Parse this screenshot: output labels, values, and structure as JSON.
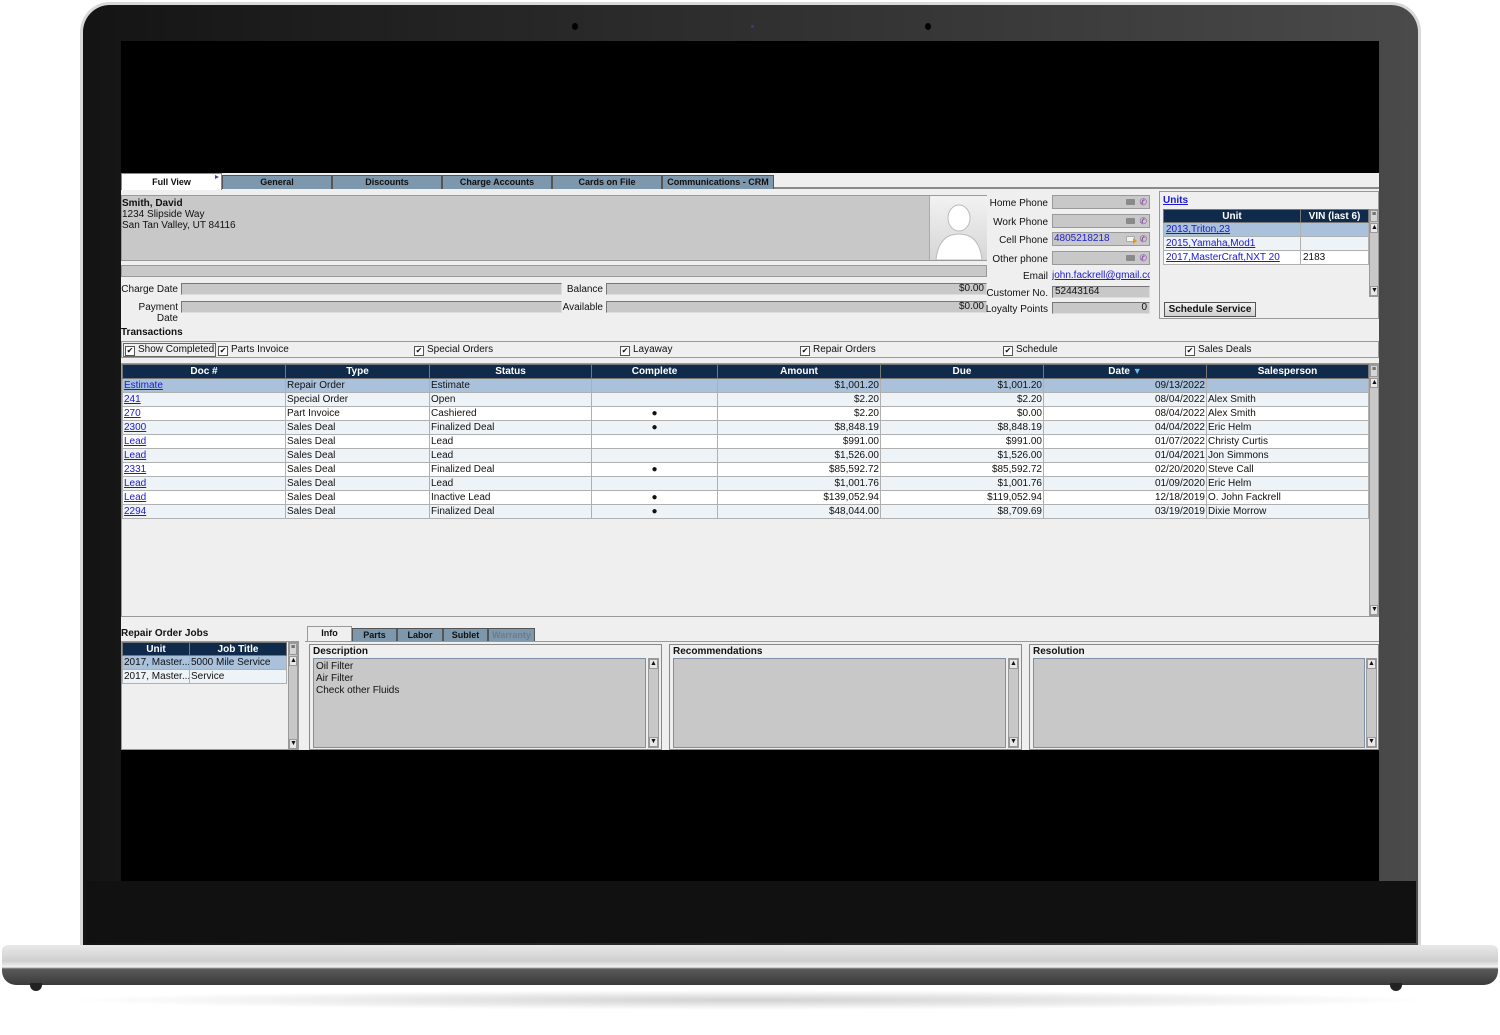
{
  "tabs": [
    {
      "label": "Full View",
      "active": true
    },
    {
      "label": "General"
    },
    {
      "label": "Discounts"
    },
    {
      "label": "Charge Accounts"
    },
    {
      "label": "Cards on File"
    },
    {
      "label": "Communications - CRM"
    }
  ],
  "customer": {
    "name": "Smith, David",
    "address1": "1234 Slipside Way",
    "address2": "San Tan Valley, UT 84116"
  },
  "account": {
    "charge_date_label": "Charge Date",
    "charge_date": "",
    "payment_date_label": "Payment Date",
    "payment_date": "",
    "balance_label": "Balance",
    "balance": "$0.00",
    "available_label": "Available",
    "available": "$0.00"
  },
  "contact": {
    "home_phone_label": "Home Phone",
    "home_phone": "",
    "work_phone_label": "Work Phone",
    "work_phone": "",
    "cell_phone_label": "Cell Phone",
    "cell_phone": "4805218218",
    "other_phone_label": "Other phone",
    "other_phone": "",
    "email_label": "Email",
    "email": "john.fackrell@gmail.cor",
    "customer_no_label": "Customer No.",
    "customer_no": "52443164",
    "loyalty_label": "Loyalty Points",
    "loyalty": "0"
  },
  "units": {
    "title": "Units",
    "columns": [
      "Unit",
      "VIN (last 6)"
    ],
    "rows": [
      {
        "unit": "2013,Triton,23",
        "vin": ""
      },
      {
        "unit": "2015,Yamaha,Mod1",
        "vin": ""
      },
      {
        "unit": "2017,MasterCraft,NXT 20",
        "vin": "2183"
      }
    ],
    "schedule_button": "Schedule Service"
  },
  "transactions": {
    "title": "Transactions",
    "filters": [
      {
        "label": "Show Completed",
        "checked": true
      },
      {
        "label": "Parts Invoice",
        "checked": true
      },
      {
        "label": "Special Orders",
        "checked": true
      },
      {
        "label": "Layaway",
        "checked": true
      },
      {
        "label": "Repair Orders",
        "checked": true
      },
      {
        "label": "Schedule",
        "checked": true
      },
      {
        "label": "Sales Deals",
        "checked": true
      }
    ],
    "columns": [
      "Doc #",
      "Type",
      "Status",
      "Complete",
      "Amount",
      "Due",
      "Date",
      "Salesperson"
    ],
    "sort_icon": "triangle-down",
    "rows": [
      {
        "doc": "Estimate",
        "type": "Repair Order",
        "status": "Estimate",
        "complete": "",
        "amount": "$1,001.20",
        "due": "$1,001.20",
        "date": "09/13/2022",
        "salesperson": ""
      },
      {
        "doc": "241",
        "type": "Special Order",
        "status": "Open",
        "complete": "",
        "amount": "$2.20",
        "due": "$2.20",
        "date": "08/04/2022",
        "salesperson": "Alex Smith"
      },
      {
        "doc": "270",
        "type": "Part Invoice",
        "status": "Cashiered",
        "complete": "●",
        "amount": "$2.20",
        "due": "$0.00",
        "date": "08/04/2022",
        "salesperson": "Alex Smith"
      },
      {
        "doc": "2300",
        "type": "Sales Deal",
        "status": "Finalized Deal",
        "complete": "●",
        "amount": "$8,848.19",
        "due": "$8,848.19",
        "date": "04/04/2022",
        "salesperson": "Eric Helm"
      },
      {
        "doc": "Lead",
        "type": "Sales Deal",
        "status": "Lead",
        "complete": "",
        "amount": "$991.00",
        "due": "$991.00",
        "date": "01/07/2022",
        "salesperson": "Christy Curtis"
      },
      {
        "doc": "Lead",
        "type": "Sales Deal",
        "status": "Lead",
        "complete": "",
        "amount": "$1,526.00",
        "due": "$1,526.00",
        "date": "01/04/2021",
        "salesperson": "Jon Simmons"
      },
      {
        "doc": "2331",
        "type": "Sales Deal",
        "status": "Finalized Deal",
        "complete": "●",
        "amount": "$85,592.72",
        "due": "$85,592.72",
        "date": "02/20/2020",
        "salesperson": "Steve Call"
      },
      {
        "doc": "Lead",
        "type": "Sales Deal",
        "status": "Lead",
        "complete": "",
        "amount": "$1,001.76",
        "due": "$1,001.76",
        "date": "01/09/2020",
        "salesperson": "Eric Helm"
      },
      {
        "doc": "Lead",
        "type": "Sales Deal",
        "status": "Inactive Lead",
        "complete": "●",
        "amount": "$139,052.94",
        "due": "$119,052.94",
        "date": "12/18/2019",
        "salesperson": "O.  John Fackrell"
      },
      {
        "doc": "2294",
        "type": "Sales Deal",
        "status": "Finalized Deal",
        "complete": "●",
        "amount": "$48,044.00",
        "due": "$8,709.69",
        "date": "03/19/2019",
        "salesperson": "Dixie Morrow"
      }
    ]
  },
  "repair_order_jobs": {
    "title": "Repair Order Jobs",
    "columns": [
      "Unit",
      "Job Title"
    ],
    "rows": [
      {
        "unit": "2017, Master...",
        "job": "5000 Mile Service"
      },
      {
        "unit": "2017, Master...",
        "job": "Service"
      }
    ]
  },
  "detail_tabs": [
    {
      "label": "Info",
      "active": true
    },
    {
      "label": "Parts"
    },
    {
      "label": "Labor"
    },
    {
      "label": "Sublet"
    },
    {
      "label": "Warranty",
      "disabled": true
    }
  ],
  "detail": {
    "description_label": "Description",
    "description_lines": [
      "Oil Filter",
      "Air Filter",
      "Check other Fluids"
    ],
    "recommendations_label": "Recommendations",
    "recommendations": "",
    "resolution_label": "Resolution",
    "resolution": ""
  }
}
